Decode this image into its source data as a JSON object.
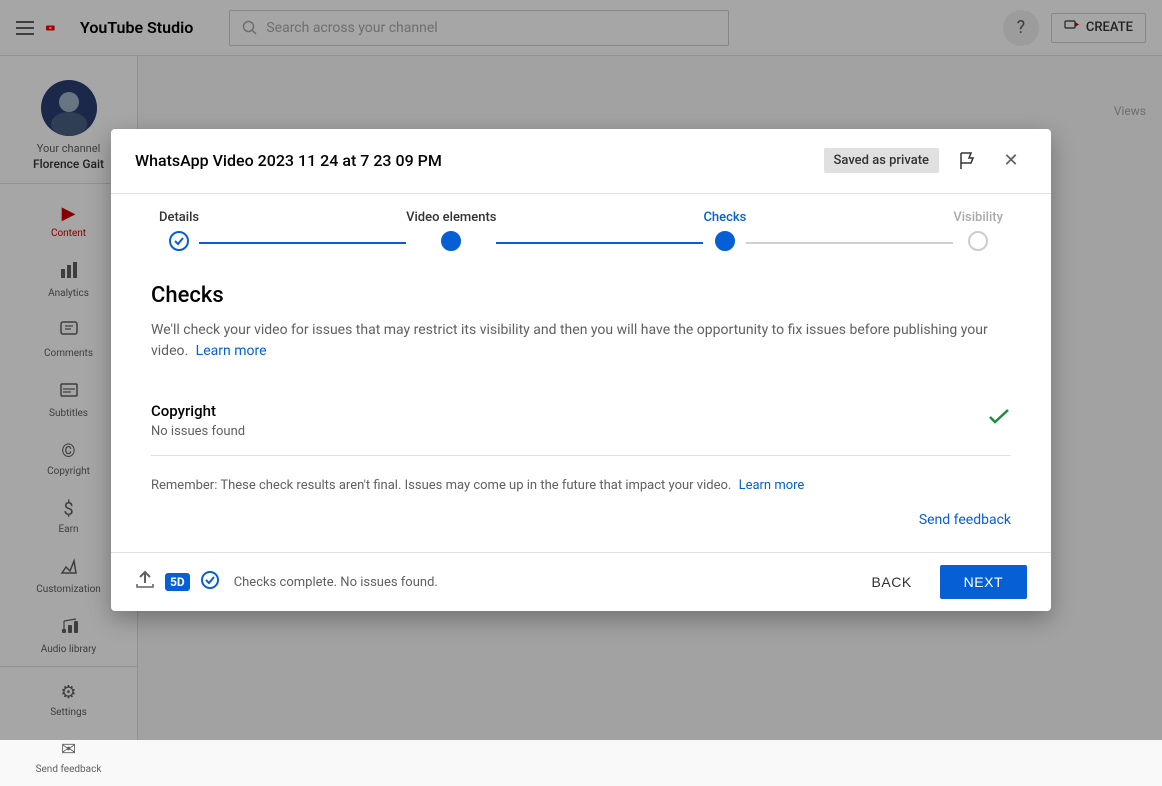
{
  "app": {
    "name": "YouTube Studio",
    "search_placeholder": "Search across your channel"
  },
  "topbar": {
    "menu_icon": "≡",
    "help_icon": "?",
    "create_label": "CREATE"
  },
  "sidebar": {
    "channel_label": "Your channel",
    "channel_name": "Florence Gait",
    "items": [
      {
        "id": "content",
        "label": "Content",
        "icon": "▶",
        "active": true
      },
      {
        "id": "analytics",
        "label": "Analytics",
        "icon": "📊"
      },
      {
        "id": "comments",
        "label": "Comments",
        "icon": "💬"
      },
      {
        "id": "subtitles",
        "label": "Subtitles",
        "icon": "📋"
      },
      {
        "id": "copyright",
        "label": "Copyright",
        "icon": "©"
      },
      {
        "id": "earn",
        "label": "Earn",
        "icon": "$"
      },
      {
        "id": "customization",
        "label": "Customization",
        "icon": "✏"
      },
      {
        "id": "audio-library",
        "label": "Audio library",
        "icon": "🎵"
      }
    ],
    "bottom_items": [
      {
        "id": "settings",
        "label": "Settings",
        "icon": "⚙"
      },
      {
        "id": "send-feedback",
        "label": "Send feedback",
        "icon": "✉"
      }
    ]
  },
  "main": {
    "views_label": "Views"
  },
  "modal": {
    "title": "WhatsApp Video 2023 11 24 at 7 23 09 PM",
    "saved_badge": "Saved as private",
    "close_icon": "✕",
    "info_icon": "⚑",
    "stepper": {
      "steps": [
        {
          "id": "details",
          "label": "Details",
          "state": "done"
        },
        {
          "id": "video-elements",
          "label": "Video elements",
          "state": "done"
        },
        {
          "id": "checks",
          "label": "Checks",
          "state": "active"
        },
        {
          "id": "visibility",
          "label": "Visibility",
          "state": "inactive"
        }
      ]
    },
    "checks": {
      "title": "Checks",
      "description": "We'll check your video for issues that may restrict its visibility and then you will have the opportunity to fix issues before publishing your video.",
      "learn_more_link": "Learn more",
      "sections": [
        {
          "name": "Copyright",
          "status": "No issues found",
          "icon": "✓",
          "icon_color": "#1e8e3e"
        }
      ],
      "reminder": "Remember: These check results aren't final. Issues may come up in the future that impact your video.",
      "learn_more_reminder_link": "Learn more",
      "send_feedback": "Send feedback"
    },
    "footer": {
      "upload_icon": "↑",
      "quality_badge": "5D",
      "check_icon": "✓",
      "status_text": "Checks complete. No issues found.",
      "back_label": "BACK",
      "next_label": "NEXT"
    }
  }
}
